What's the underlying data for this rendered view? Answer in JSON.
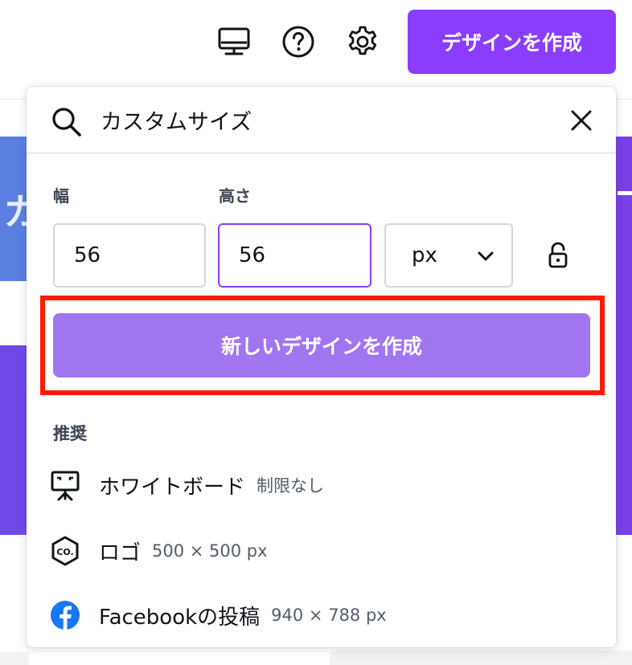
{
  "header": {
    "create_button_label": "デザインを作成",
    "icons": [
      "desktop-icon",
      "help-icon",
      "settings-icon"
    ]
  },
  "background": {
    "banner_letter": "カ"
  },
  "dropdown": {
    "search": {
      "value": "カスタムサイズ",
      "placeholder": ""
    },
    "width": {
      "label": "幅",
      "value": "56"
    },
    "height": {
      "label": "高さ",
      "value": "56"
    },
    "unit": {
      "value": "px"
    },
    "create_new_label": "新しいデザインを作成",
    "recommended": {
      "title": "推奨",
      "items": [
        {
          "name": "ホワイトボード",
          "size": "制限なし",
          "icon": "whiteboard-icon"
        },
        {
          "name": "ロゴ",
          "size": "500 × 500 px",
          "icon": "logo-icon"
        },
        {
          "name": "Facebookの投稿",
          "size": "940 × 788 px",
          "icon": "facebook-icon"
        }
      ]
    }
  },
  "colors": {
    "brand_purple": "#8b3dff",
    "button_disabled_purple": "#a275f0",
    "highlight_red": "#ff1a00",
    "facebook_blue": "#1877f2"
  }
}
